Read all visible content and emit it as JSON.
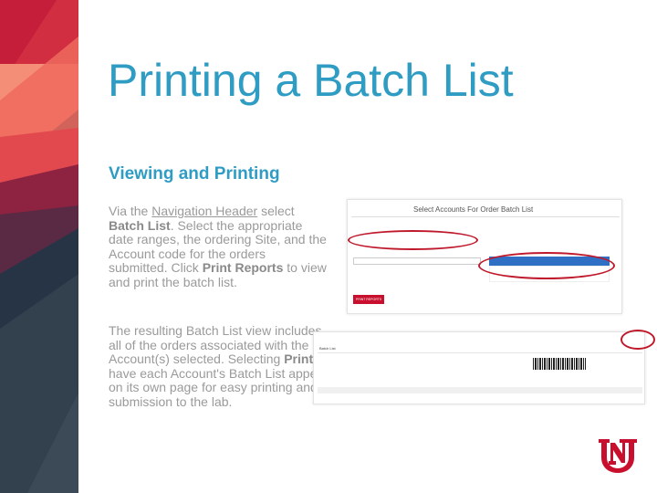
{
  "title": "Printing a Batch List",
  "subtitle": "Viewing and Printing",
  "paragraph1": {
    "pre": "Via the ",
    "link": "Navigation Header",
    "mid1": " select ",
    "bold1": "Batch List",
    "mid2": ".  Select the appropriate date ranges, the ordering Site, and the Account code for the orders submitted.  Click ",
    "bold2": "Print Reports",
    "post": " to view and print the batch list."
  },
  "paragraph2": {
    "pre": "The resulting Batch List view includes all of the orders associated with the Account(s) selected.  Selecting ",
    "bold": "Print",
    "post": " will have each Account's Batch List appear on its own page for easy printing and submission to the lab."
  },
  "screenshot1": {
    "title": "Select Accounts For Order Batch List",
    "button": "PRINT REPORTS"
  },
  "screenshot2": {
    "title": "Batch List"
  },
  "colors": {
    "accent": "#2f9cc4",
    "highlight_oval": "#c0182b",
    "brand_red": "#c8102e"
  }
}
